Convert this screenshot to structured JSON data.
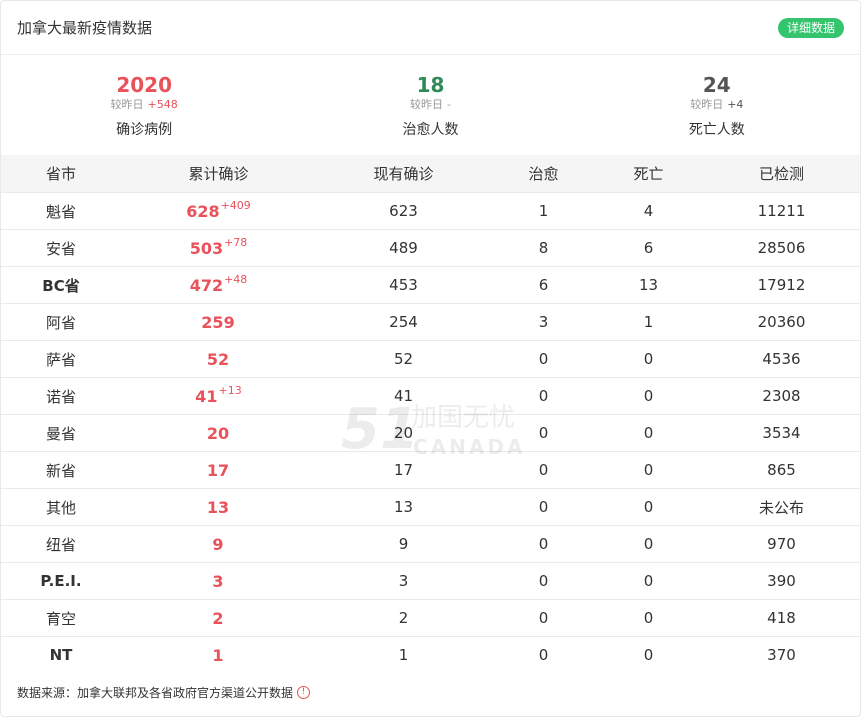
{
  "header": {
    "title": "加拿大最新疫情数据",
    "detail_button": "详细数据"
  },
  "stats": [
    {
      "value": "2020",
      "delta_label": "较昨日",
      "delta": "+548",
      "label": "确诊病例"
    },
    {
      "value": "18",
      "delta_label": "较昨日",
      "delta": "-",
      "label": "治愈人数"
    },
    {
      "value": "24",
      "delta_label": "较昨日",
      "delta": "+4",
      "label": "死亡人数"
    }
  ],
  "table": {
    "headers": [
      "省市",
      "累计确诊",
      "现有确诊",
      "治愈",
      "死亡",
      "已检测"
    ],
    "rows": [
      {
        "province": "魁省",
        "confirmed": "628",
        "increase": "+409",
        "current": "623",
        "cured": "1",
        "deaths": "4",
        "tested": "11211"
      },
      {
        "province": "安省",
        "confirmed": "503",
        "increase": "+78",
        "current": "489",
        "cured": "8",
        "deaths": "6",
        "tested": "28506"
      },
      {
        "province": "BC省",
        "confirmed": "472",
        "increase": "+48",
        "current": "453",
        "cured": "6",
        "deaths": "13",
        "tested": "17912"
      },
      {
        "province": "阿省",
        "confirmed": "259",
        "increase": "",
        "current": "254",
        "cured": "3",
        "deaths": "1",
        "tested": "20360"
      },
      {
        "province": "萨省",
        "confirmed": "52",
        "increase": "",
        "current": "52",
        "cured": "0",
        "deaths": "0",
        "tested": "4536"
      },
      {
        "province": "诺省",
        "confirmed": "41",
        "increase": "+13",
        "current": "41",
        "cured": "0",
        "deaths": "0",
        "tested": "2308"
      },
      {
        "province": "曼省",
        "confirmed": "20",
        "increase": "",
        "current": "20",
        "cured": "0",
        "deaths": "0",
        "tested": "3534"
      },
      {
        "province": "新省",
        "confirmed": "17",
        "increase": "",
        "current": "17",
        "cured": "0",
        "deaths": "0",
        "tested": "865"
      },
      {
        "province": "其他",
        "confirmed": "13",
        "increase": "",
        "current": "13",
        "cured": "0",
        "deaths": "0",
        "tested": "未公布"
      },
      {
        "province": "纽省",
        "confirmed": "9",
        "increase": "",
        "current": "9",
        "cured": "0",
        "deaths": "0",
        "tested": "970"
      },
      {
        "province": "P.E.I.",
        "confirmed": "3",
        "increase": "",
        "current": "3",
        "cured": "0",
        "deaths": "0",
        "tested": "390"
      },
      {
        "province": "育空",
        "confirmed": "2",
        "increase": "",
        "current": "2",
        "cured": "0",
        "deaths": "0",
        "tested": "418"
      },
      {
        "province": "NT",
        "confirmed": "1",
        "increase": "",
        "current": "1",
        "cured": "0",
        "deaths": "0",
        "tested": "370"
      }
    ]
  },
  "footer": {
    "source": "数据来源：加拿大联邦及各省政府官方渠道公开数据",
    "icon": "info-icon"
  },
  "watermark": {
    "number": "51",
    "name": "加国无忧",
    "sub": "CANADA"
  },
  "colors": {
    "accent_red": "#e9525a",
    "accent_green": "#2e8a57",
    "button_green": "#34c46e"
  }
}
